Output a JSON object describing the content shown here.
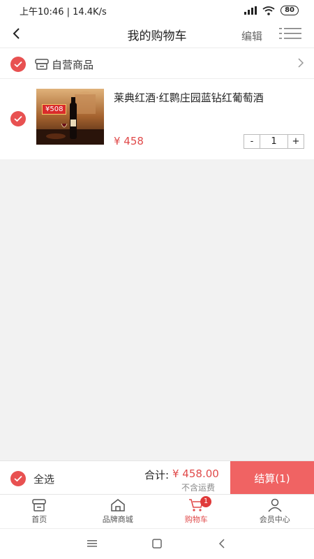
{
  "status_bar": {
    "time_speed": "上午10:46 | 14.4K/s",
    "battery": "80"
  },
  "header": {
    "title": "我的购物车",
    "edit_label": "编辑"
  },
  "shop": {
    "name": "自营商品",
    "item": {
      "name": "莱典红酒·红鹮庄园蓝钻红葡萄酒",
      "price": "¥ 458",
      "quantity": "1",
      "minus": "-",
      "plus": "+",
      "thumb_badge": "¥508"
    }
  },
  "checkout": {
    "select_all": "全选",
    "total_label": "合计:",
    "total_value": "¥ 458.00",
    "shipping_note": "不含运费",
    "button": "结算(1)"
  },
  "tabs": [
    {
      "label": "首页",
      "icon": "shop-icon"
    },
    {
      "label": "品牌商城",
      "icon": "home-icon"
    },
    {
      "label": "购物车",
      "icon": "cart-icon",
      "badge": "1",
      "active": true
    },
    {
      "label": "会员中心",
      "icon": "user-icon"
    }
  ],
  "colors": {
    "accent": "#e85151",
    "checkout_button": "#f06363",
    "price": "#e04a4a"
  }
}
